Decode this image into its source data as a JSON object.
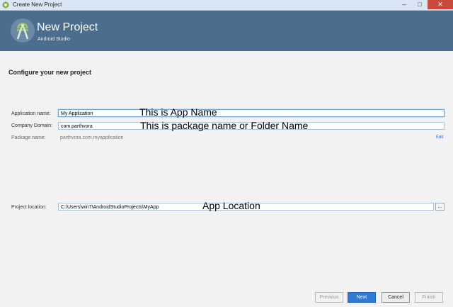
{
  "window": {
    "title": "Create New Project",
    "minimize": "–",
    "maximize": "□",
    "close": "✕"
  },
  "banner": {
    "title": "New Project",
    "subtitle": "Android Studio",
    "logo_icon": "android-studio-logo"
  },
  "section_title": "Configure your new project",
  "form": {
    "app_name_label": "Application name:",
    "app_name_value": "My Application",
    "company_domain_label": "Company Domain:",
    "company_domain_value": "com.parthvora",
    "package_label": "Package name:",
    "package_value": "parthvora.com.myapplication",
    "edit_link": "Edit",
    "location_label": "Project location:",
    "location_value": "C:\\Users\\win7\\AndroidStudioProjects\\MyApp",
    "browse_label": "..."
  },
  "annotations": {
    "app_name": "This is App Name",
    "package": "This is package name or Folder Name",
    "location": "App Location"
  },
  "buttons": {
    "previous": "Previous",
    "next": "Next",
    "cancel": "Cancel",
    "finish": "Finish"
  },
  "colors": {
    "banner": "#4b6d8e",
    "primary_button": "#2f7ad4",
    "close_button": "#c94a3a"
  }
}
